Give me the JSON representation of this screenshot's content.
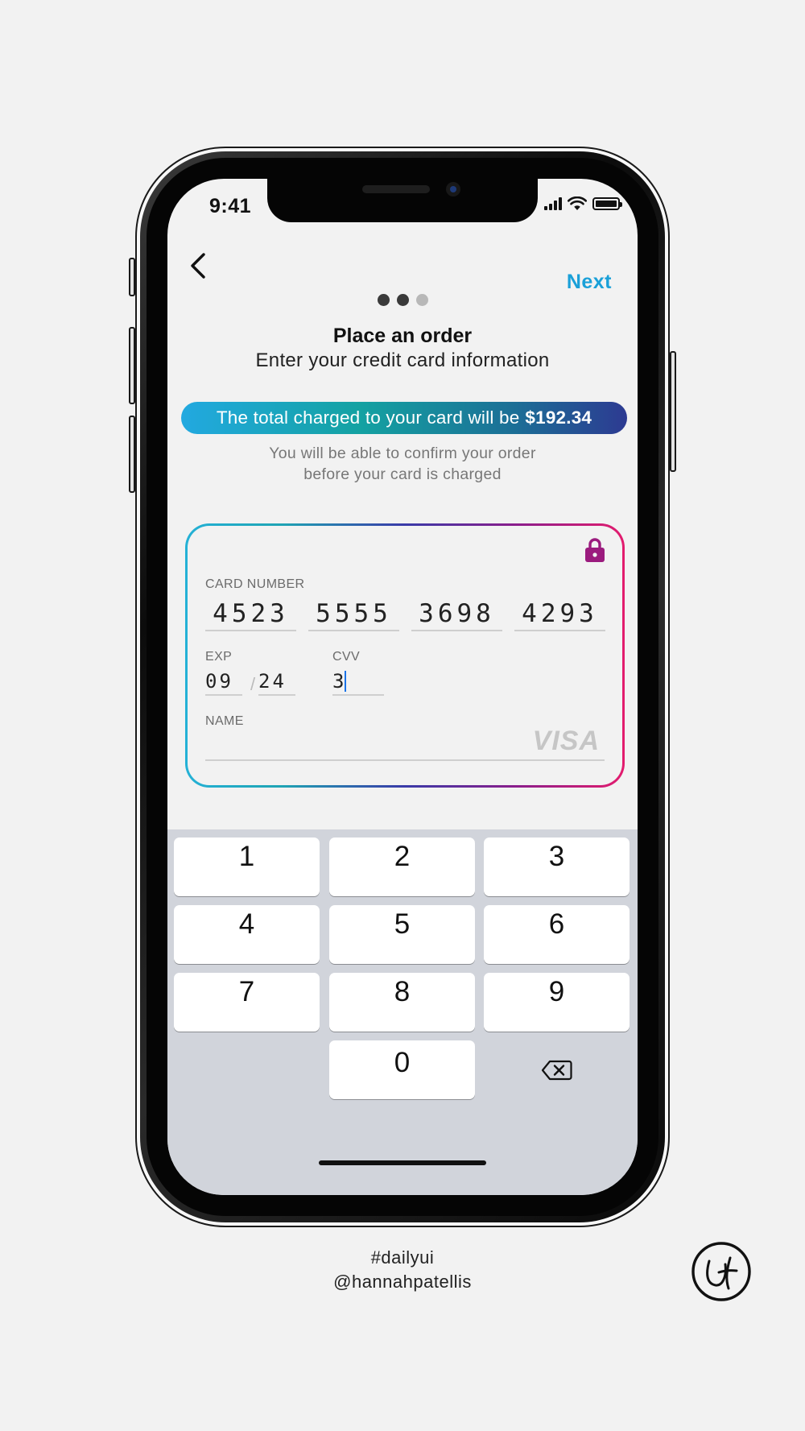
{
  "status_bar": {
    "time": "9:41"
  },
  "nav": {
    "next_label": "Next",
    "dots_total": 3,
    "active_dots": 2
  },
  "header": {
    "title": "Place an order",
    "subtitle": "Enter your credit card information"
  },
  "total": {
    "prefix": "The total charged to your card will be",
    "amount": "$192.34"
  },
  "confirm_note": {
    "line1": "You will be able to confirm your order",
    "line2": "before your card is charged"
  },
  "card_form": {
    "card_number_label": "CARD NUMBER",
    "card_number_groups": [
      "4523",
      "5555",
      "3698",
      "4293"
    ],
    "exp_label": "EXP",
    "exp_month": "09",
    "exp_separator": "/",
    "exp_year": "24",
    "cvv_label": "CVV",
    "cvv_value": "3",
    "name_label": "NAME",
    "name_value": "",
    "brand": "VISA"
  },
  "keypad": {
    "keys": [
      "1",
      "2",
      "3",
      "4",
      "5",
      "6",
      "7",
      "8",
      "9",
      "0"
    ]
  },
  "footer": {
    "hashtag": "#dailyui",
    "handle": "@hannahpatellis"
  },
  "colors": {
    "accent": "#1aa0d8",
    "gradient_start": "#22a9e0",
    "gradient_end": "#e31c6e",
    "lock": "#9b1b7e"
  }
}
